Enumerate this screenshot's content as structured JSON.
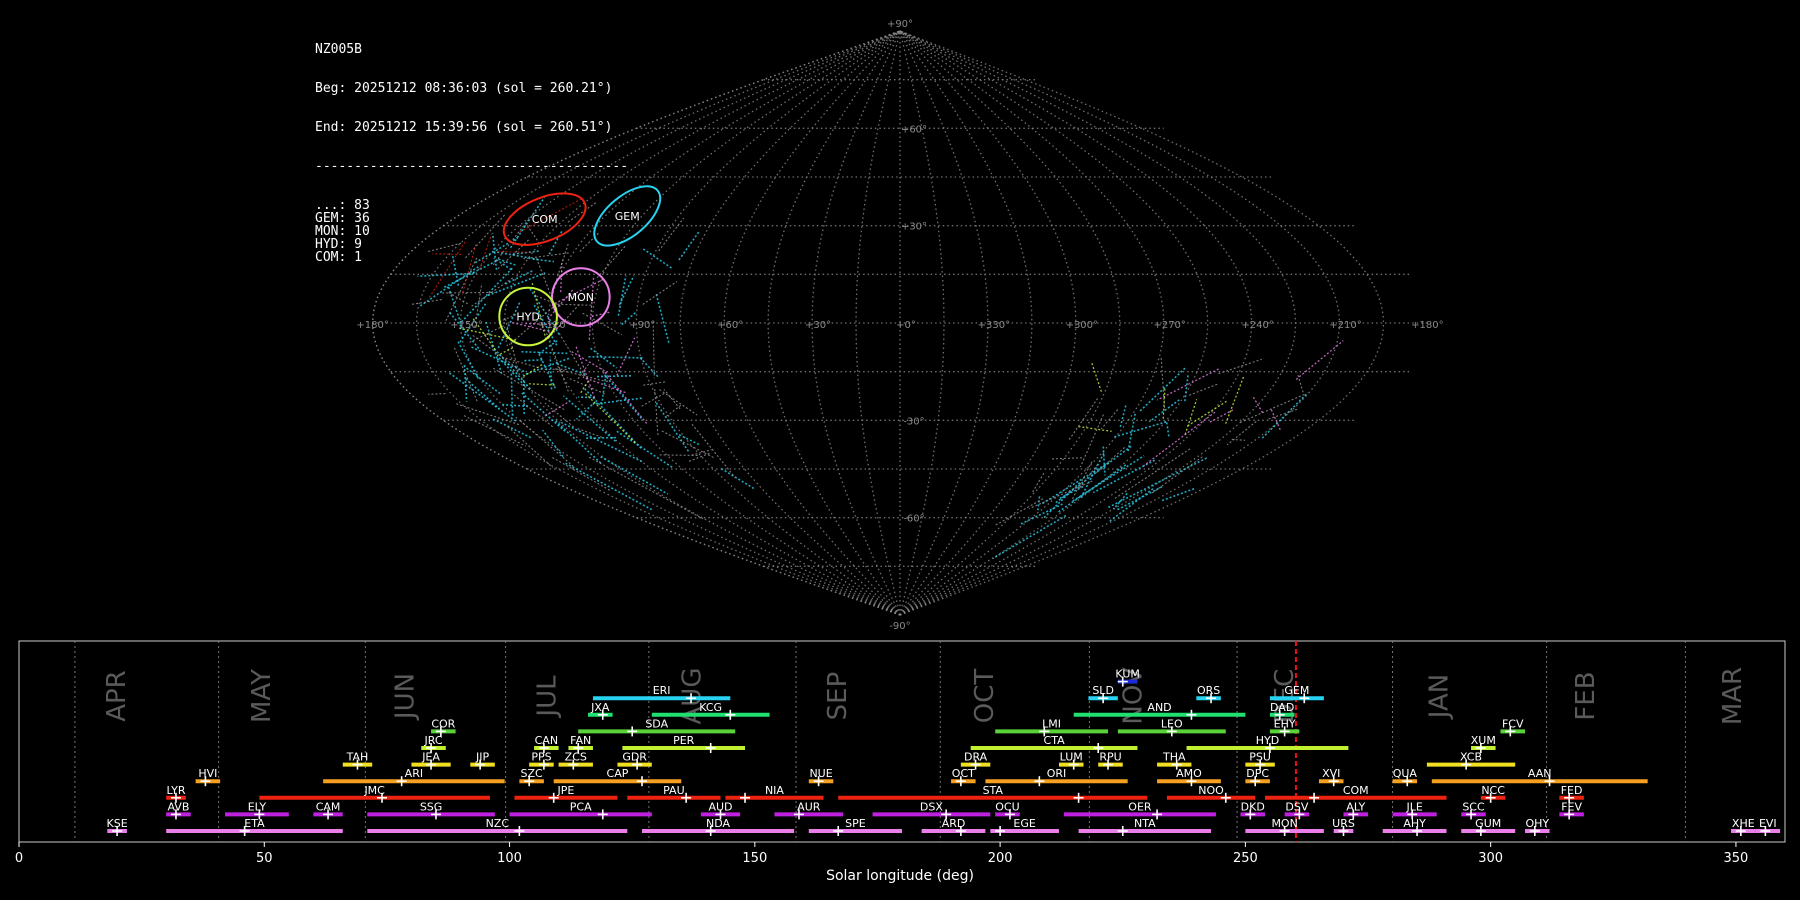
{
  "header": {
    "station": "NZ005B",
    "begin": "Beg: 20251212 08:36:03 (sol = 260.21°)",
    "end": "End: 20251212 15:39:56 (sol = 260.51°)",
    "separator": "----------------------------------------",
    "counts": [
      {
        "code": "...",
        "n": 83
      },
      {
        "code": "GEM",
        "n": 36
      },
      {
        "code": "MON",
        "n": 10
      },
      {
        "code": "HYD",
        "n": 9
      },
      {
        "code": "COM",
        "n": 1
      }
    ]
  },
  "colors": {
    "sporadic": "#9a9a9a",
    "GEM": "#27d3f0",
    "MON": "#ea7fea",
    "HYD": "#c8f53a",
    "COM": "#ee2211",
    "grid": "#8a8a8a",
    "axis_text": "#8a8a8a",
    "month_text": "#5a5a5a",
    "frame": "#cccccc"
  },
  "chart_data": [
    {
      "type": "scatter",
      "projection": "sinusoidal",
      "lon_ticks": [
        "+180°",
        "+150°",
        "+120°",
        "+90°",
        "+60°",
        "+30°",
        "+0°",
        "+330°",
        "+300°",
        "+270°",
        "+240°",
        "+210°",
        "+180°"
      ],
      "lat_ticks": [
        "+90°",
        "+60°",
        "+30°",
        "-30°",
        "-60°",
        "-90°"
      ],
      "radiants": [
        {
          "code": "COM",
          "lon": 143,
          "lat": 32,
          "rx": 12,
          "ry": 6,
          "angle": -22
        },
        {
          "code": "GEM",
          "lon": 111,
          "lat": 33,
          "rx": 11,
          "ry": 5.5,
          "angle": -40
        },
        {
          "code": "MON",
          "lon": 110,
          "lat": 8,
          "rx": 8,
          "ry": 8,
          "angle": 0
        },
        {
          "code": "HYD",
          "lon": 127,
          "lat": 2,
          "rx": 8,
          "ry": 8,
          "angle": 0
        }
      ]
    },
    {
      "type": "bar",
      "xlabel": "Solar longitude (deg)",
      "xlim": [
        0,
        360
      ],
      "xticks": [
        0,
        50,
        100,
        150,
        200,
        250,
        300,
        350
      ],
      "current_sol": 260.3,
      "months": [
        {
          "label": "APR",
          "start": 11.4
        },
        {
          "label": "MAY",
          "start": 40.7
        },
        {
          "label": "JUN",
          "start": 70.6
        },
        {
          "label": "JUL",
          "start": 99.2
        },
        {
          "label": "AUG",
          "start": 128.4
        },
        {
          "label": "SEP",
          "start": 158.4
        },
        {
          "label": "OCT",
          "start": 187.8
        },
        {
          "label": "NOV",
          "start": 218.2
        },
        {
          "label": "DEC",
          "start": 248.3
        },
        {
          "label": "JAN",
          "start": 280.0
        },
        {
          "label": "FEB",
          "start": 311.4
        },
        {
          "label": "MAR",
          "start": 339.7
        }
      ],
      "showers": [
        {
          "code": "KUM",
          "start": 224,
          "end": 228,
          "peak": 225,
          "row": 10,
          "color": "#1a2ad8"
        },
        {
          "code": "ERI",
          "start": 117,
          "end": 145,
          "peak": 137,
          "row": 9,
          "color": "#27d3f0"
        },
        {
          "code": "SLD",
          "start": 218,
          "end": 224,
          "peak": 221,
          "row": 9,
          "color": "#27d3f0"
        },
        {
          "code": "ORS",
          "start": 240,
          "end": 245,
          "peak": 243,
          "row": 9,
          "color": "#27d3f0"
        },
        {
          "code": "GEM",
          "start": 255,
          "end": 266,
          "peak": 262,
          "row": 9,
          "color": "#27d3f0"
        },
        {
          "code": "JXA",
          "start": 116,
          "end": 121,
          "peak": 119,
          "row": 8,
          "color": "#20e070"
        },
        {
          "code": "KCG",
          "start": 129,
          "end": 153,
          "peak": 145,
          "row": 8,
          "color": "#20e070"
        },
        {
          "code": "AND",
          "start": 215,
          "end": 250,
          "peak": 239,
          "row": 8,
          "color": "#20e070"
        },
        {
          "code": "DAD",
          "start": 255,
          "end": 260,
          "peak": 257,
          "row": 8,
          "color": "#20e070"
        },
        {
          "code": "COR",
          "start": 84,
          "end": 89,
          "peak": 86,
          "row": 7,
          "color": "#5ad23a"
        },
        {
          "code": "SDA",
          "start": 114,
          "end": 146,
          "peak": 125,
          "row": 7,
          "color": "#5ad23a"
        },
        {
          "code": "LMI",
          "start": 199,
          "end": 222,
          "peak": 209,
          "row": 7,
          "color": "#5ad23a"
        },
        {
          "code": "LEO",
          "start": 224,
          "end": 246,
          "peak": 235,
          "row": 7,
          "color": "#5ad23a"
        },
        {
          "code": "EHY",
          "start": 255,
          "end": 261,
          "peak": 258,
          "row": 7,
          "color": "#5ad23a"
        },
        {
          "code": "FCV",
          "start": 302,
          "end": 307,
          "peak": 304,
          "row": 7,
          "color": "#5ad23a"
        },
        {
          "code": "JRC",
          "start": 82,
          "end": 87,
          "peak": 84,
          "row": 6,
          "color": "#c0f030"
        },
        {
          "code": "CAN",
          "start": 105,
          "end": 110,
          "peak": 107,
          "row": 6,
          "color": "#c0f030"
        },
        {
          "code": "FAN",
          "start": 112,
          "end": 117,
          "peak": 114,
          "row": 6,
          "color": "#c0f030"
        },
        {
          "code": "PER",
          "start": 123,
          "end": 148,
          "peak": 141,
          "row": 6,
          "color": "#c0f030"
        },
        {
          "code": "CTA",
          "start": 194,
          "end": 228,
          "peak": 220,
          "row": 6,
          "color": "#c0f030"
        },
        {
          "code": "HYD",
          "start": 238,
          "end": 271,
          "peak": 255,
          "row": 6,
          "color": "#c0f030"
        },
        {
          "code": "XUM",
          "start": 296,
          "end": 301,
          "peak": 298,
          "row": 6,
          "color": "#c0f030"
        },
        {
          "code": "TAH",
          "start": 66,
          "end": 72,
          "peak": 69,
          "row": 5,
          "color": "#f0e020"
        },
        {
          "code": "JEA",
          "start": 80,
          "end": 88,
          "peak": 84,
          "row": 5,
          "color": "#f0e020"
        },
        {
          "code": "JIP",
          "start": 92,
          "end": 97,
          "peak": 94,
          "row": 5,
          "color": "#f0e020"
        },
        {
          "code": "PPS",
          "start": 104,
          "end": 109,
          "peak": 107,
          "row": 5,
          "color": "#f0e020"
        },
        {
          "code": "ZCS",
          "start": 110,
          "end": 117,
          "peak": 113,
          "row": 5,
          "color": "#f0e020"
        },
        {
          "code": "GDR",
          "start": 122,
          "end": 129,
          "peak": 126,
          "row": 5,
          "color": "#f0e020"
        },
        {
          "code": "DRA",
          "start": 192,
          "end": 198,
          "peak": 195,
          "row": 5,
          "color": "#f0e020"
        },
        {
          "code": "LUM",
          "start": 212,
          "end": 217,
          "peak": 215,
          "row": 5,
          "color": "#f0e020"
        },
        {
          "code": "RPU",
          "start": 220,
          "end": 225,
          "peak": 222,
          "row": 5,
          "color": "#f0e020"
        },
        {
          "code": "THA",
          "start": 232,
          "end": 239,
          "peak": 236,
          "row": 5,
          "color": "#f0e020"
        },
        {
          "code": "PSU",
          "start": 250,
          "end": 256,
          "peak": 253,
          "row": 5,
          "color": "#f0e020"
        },
        {
          "code": "XCB",
          "start": 287,
          "end": 305,
          "peak": 295,
          "row": 5,
          "color": "#f0e020"
        },
        {
          "code": "HVI",
          "start": 36,
          "end": 41,
          "peak": 38,
          "row": 4,
          "color": "#f5a020"
        },
        {
          "code": "ARI",
          "start": 62,
          "end": 99,
          "peak": 78,
          "row": 4,
          "color": "#f5a020"
        },
        {
          "code": "SZC",
          "start": 102,
          "end": 107,
          "peak": 104,
          "row": 4,
          "color": "#f5a020"
        },
        {
          "code": "CAP",
          "start": 109,
          "end": 135,
          "peak": 127,
          "row": 4,
          "color": "#f5a020"
        },
        {
          "code": "NUE",
          "start": 161,
          "end": 166,
          "peak": 163,
          "row": 4,
          "color": "#f5a020"
        },
        {
          "code": "OCT",
          "start": 190,
          "end": 195,
          "peak": 192,
          "row": 4,
          "color": "#f5a020"
        },
        {
          "code": "ORI",
          "start": 197,
          "end": 226,
          "peak": 208,
          "row": 4,
          "color": "#f5a020"
        },
        {
          "code": "AMO",
          "start": 232,
          "end": 245,
          "peak": 239,
          "row": 4,
          "color": "#f5a020"
        },
        {
          "code": "DPC",
          "start": 250,
          "end": 255,
          "peak": 252,
          "row": 4,
          "color": "#f5a020"
        },
        {
          "code": "XVI",
          "start": 265,
          "end": 270,
          "peak": 268,
          "row": 4,
          "color": "#f5a020"
        },
        {
          "code": "QUA",
          "start": 280,
          "end": 285,
          "peak": 283,
          "row": 4,
          "color": "#f5a020"
        },
        {
          "code": "AAN",
          "start": 288,
          "end": 332,
          "peak": 312,
          "row": 4,
          "color": "#f5a020"
        },
        {
          "code": "LYR",
          "start": 30,
          "end": 34,
          "peak": 32,
          "row": 3,
          "color": "#ee2211"
        },
        {
          "code": "JMC",
          "start": 49,
          "end": 96,
          "peak": 74,
          "row": 3,
          "color": "#ee2211"
        },
        {
          "code": "JPE",
          "start": 101,
          "end": 122,
          "peak": 109,
          "row": 3,
          "color": "#ee2211"
        },
        {
          "code": "PAU",
          "start": 124,
          "end": 143,
          "peak": 136,
          "row": 3,
          "color": "#ee2211"
        },
        {
          "code": "NIA",
          "start": 144,
          "end": 164,
          "peak": 148,
          "row": 3,
          "color": "#ee2211"
        },
        {
          "code": "STA",
          "start": 167,
          "end": 230,
          "peak": 216,
          "row": 3,
          "color": "#ee2211"
        },
        {
          "code": "NOO",
          "start": 234,
          "end": 252,
          "peak": 246,
          "row": 3,
          "color": "#ee2211"
        },
        {
          "code": "COM",
          "start": 254,
          "end": 291,
          "peak": 264,
          "row": 3,
          "color": "#ee2211"
        },
        {
          "code": "NCC",
          "start": 298,
          "end": 303,
          "peak": 300,
          "row": 3,
          "color": "#ee2211"
        },
        {
          "code": "FED",
          "start": 314,
          "end": 319,
          "peak": 316,
          "row": 3,
          "color": "#ee2211"
        },
        {
          "code": "AVB",
          "start": 30,
          "end": 35,
          "peak": 32,
          "row": 2,
          "color": "#c020e0"
        },
        {
          "code": "ELY",
          "start": 42,
          "end": 55,
          "peak": 49,
          "row": 2,
          "color": "#c020e0"
        },
        {
          "code": "CAM",
          "start": 60,
          "end": 66,
          "peak": 63,
          "row": 2,
          "color": "#c020e0"
        },
        {
          "code": "SSG",
          "start": 71,
          "end": 97,
          "peak": 85,
          "row": 2,
          "color": "#c020e0"
        },
        {
          "code": "PCA",
          "start": 100,
          "end": 129,
          "peak": 119,
          "row": 2,
          "color": "#c020e0"
        },
        {
          "code": "AUD",
          "start": 139,
          "end": 147,
          "peak": 143,
          "row": 2,
          "color": "#c020e0"
        },
        {
          "code": "AUR",
          "start": 154,
          "end": 168,
          "peak": 159,
          "row": 2,
          "color": "#c020e0"
        },
        {
          "code": "DSX",
          "start": 174,
          "end": 198,
          "peak": 189,
          "row": 2,
          "color": "#c020e0"
        },
        {
          "code": "OCU",
          "start": 199,
          "end": 204,
          "peak": 202,
          "row": 2,
          "color": "#c020e0"
        },
        {
          "code": "OER",
          "start": 213,
          "end": 244,
          "peak": 232,
          "row": 2,
          "color": "#c020e0"
        },
        {
          "code": "DKD",
          "start": 249,
          "end": 254,
          "peak": 251,
          "row": 2,
          "color": "#c020e0"
        },
        {
          "code": "DSV",
          "start": 258,
          "end": 263,
          "peak": 261,
          "row": 2,
          "color": "#c020e0"
        },
        {
          "code": "ALY",
          "start": 270,
          "end": 275,
          "peak": 272,
          "row": 2,
          "color": "#c020e0"
        },
        {
          "code": "JLE",
          "start": 280,
          "end": 289,
          "peak": 284,
          "row": 2,
          "color": "#c020e0"
        },
        {
          "code": "SCC",
          "start": 294,
          "end": 299,
          "peak": 296,
          "row": 2,
          "color": "#c020e0"
        },
        {
          "code": "FEV",
          "start": 314,
          "end": 319,
          "peak": 316,
          "row": 2,
          "color": "#c020e0"
        },
        {
          "code": "KSE",
          "start": 18,
          "end": 22,
          "peak": 20,
          "row": 1,
          "color": "#ea7fea"
        },
        {
          "code": "ETA",
          "start": 30,
          "end": 66,
          "peak": 46,
          "row": 1,
          "color": "#ea7fea"
        },
        {
          "code": "NZC",
          "start": 71,
          "end": 124,
          "peak": 102,
          "row": 1,
          "color": "#ea7fea"
        },
        {
          "code": "NDA",
          "start": 127,
          "end": 158,
          "peak": 141,
          "row": 1,
          "color": "#ea7fea"
        },
        {
          "code": "SPE",
          "start": 161,
          "end": 180,
          "peak": 167,
          "row": 1,
          "color": "#ea7fea"
        },
        {
          "code": "ARD",
          "start": 184,
          "end": 197,
          "peak": 192,
          "row": 1,
          "color": "#ea7fea"
        },
        {
          "code": "EGE",
          "start": 198,
          "end": 212,
          "peak": 200,
          "row": 1,
          "color": "#ea7fea"
        },
        {
          "code": "NTA",
          "start": 216,
          "end": 243,
          "peak": 225,
          "row": 1,
          "color": "#ea7fea"
        },
        {
          "code": "MON",
          "start": 250,
          "end": 266,
          "peak": 258,
          "row": 1,
          "color": "#ea7fea"
        },
        {
          "code": "URS",
          "start": 268,
          "end": 272,
          "peak": 270,
          "row": 1,
          "color": "#ea7fea"
        },
        {
          "code": "AHY",
          "start": 278,
          "end": 291,
          "peak": 285,
          "row": 1,
          "color": "#ea7fea"
        },
        {
          "code": "GUM",
          "start": 294,
          "end": 305,
          "peak": 298,
          "row": 1,
          "color": "#ea7fea"
        },
        {
          "code": "OHY",
          "start": 307,
          "end": 312,
          "peak": 309,
          "row": 1,
          "color": "#ea7fea"
        },
        {
          "code": "XHE",
          "start": 349,
          "end": 354,
          "peak": 351,
          "row": 1,
          "color": "#ea7fea"
        },
        {
          "code": "EVI",
          "start": 354,
          "end": 359,
          "peak": 356,
          "row": 1,
          "color": "#ea7fea"
        }
      ]
    }
  ]
}
